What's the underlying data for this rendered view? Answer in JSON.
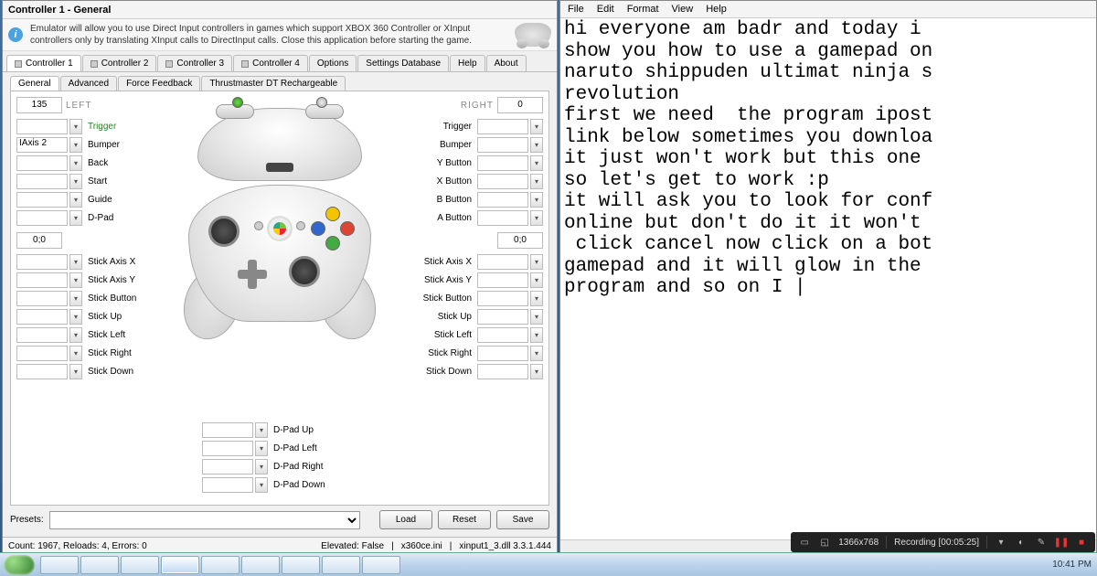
{
  "leftApp": {
    "title": "Controller 1 - General",
    "infoText": "Emulator will allow you to use Direct Input controllers in games which support XBOX 360 Controller or XInput controllers only by translating XInput calls to DirectInput calls. Close this application before starting the game.",
    "mainTabs": [
      "Controller 1",
      "Controller 2",
      "Controller 3",
      "Controller 4",
      "Options",
      "Settings Database",
      "Help",
      "About"
    ],
    "subTabs": [
      "General",
      "Advanced",
      "Force Feedback",
      "Thrustmaster DT Rechargeable"
    ],
    "left": {
      "readout": "135",
      "label": "LEFT",
      "rows": [
        {
          "value": "",
          "label": "Trigger",
          "green": true
        },
        {
          "value": "IAxis 2",
          "label": "Bumper"
        },
        {
          "value": "",
          "label": "Back"
        },
        {
          "value": "",
          "label": "Start"
        },
        {
          "value": "",
          "label": "Guide"
        },
        {
          "value": "",
          "label": "D-Pad"
        }
      ],
      "stickReadout": "0;0",
      "stickRows": [
        {
          "value": "",
          "label": "Stick Axis X"
        },
        {
          "value": "",
          "label": "Stick Axis Y"
        },
        {
          "value": "",
          "label": "Stick Button"
        },
        {
          "value": "",
          "label": "Stick Up"
        },
        {
          "value": "",
          "label": "Stick Left"
        },
        {
          "value": "",
          "label": "Stick Right"
        },
        {
          "value": "",
          "label": "Stick Down"
        }
      ]
    },
    "right": {
      "readout": "0",
      "label": "RIGHT",
      "rows": [
        {
          "label": "Trigger"
        },
        {
          "label": "Bumper"
        },
        {
          "label": "Y Button"
        },
        {
          "label": "X Button"
        },
        {
          "label": "B Button"
        },
        {
          "label": "A Button"
        }
      ],
      "stickReadout": "0;0",
      "stickRows": [
        {
          "label": "Stick Axis X"
        },
        {
          "label": "Stick Axis Y"
        },
        {
          "label": "Stick Button"
        },
        {
          "label": "Stick Up"
        },
        {
          "label": "Stick Left"
        },
        {
          "label": "Stick Right"
        },
        {
          "label": "Stick Down"
        }
      ]
    },
    "dpad": [
      {
        "label": "D-Pad Up"
      },
      {
        "label": "D-Pad Left"
      },
      {
        "label": "D-Pad Right"
      },
      {
        "label": "D-Pad Down"
      }
    ],
    "presetsLabel": "Presets:",
    "buttons": {
      "load": "Load",
      "reset": "Reset",
      "save": "Save"
    },
    "status": {
      "left": "Count: 1967, Reloads: 4, Errors: 0",
      "elevated": "Elevated: False",
      "ini": "x360ce.ini",
      "dll": "xinput1_3.dll 3.3.1.444"
    }
  },
  "notepad": {
    "menus": [
      "File",
      "Edit",
      "Format",
      "View",
      "Help"
    ],
    "body": "hi everyone am badr and today i \nshow you how to use a gamepad on\nnaruto shippuden ultimat ninja s\nrevolution\nfirst we need  the program ipost\nlink below sometimes you downloa\nit just won't work but this one \nso let's get to work :p\nit will ask you to look for conf\nonline but don't do it it won't \n click cancel now click on a bot\ngamepad and it will glow in the\nprogram and so on I |"
  },
  "recorder": {
    "resolution": "1366x768",
    "recording": "Recording [00:05:25]"
  },
  "taskbar": {
    "clock": "10:41 PM"
  }
}
